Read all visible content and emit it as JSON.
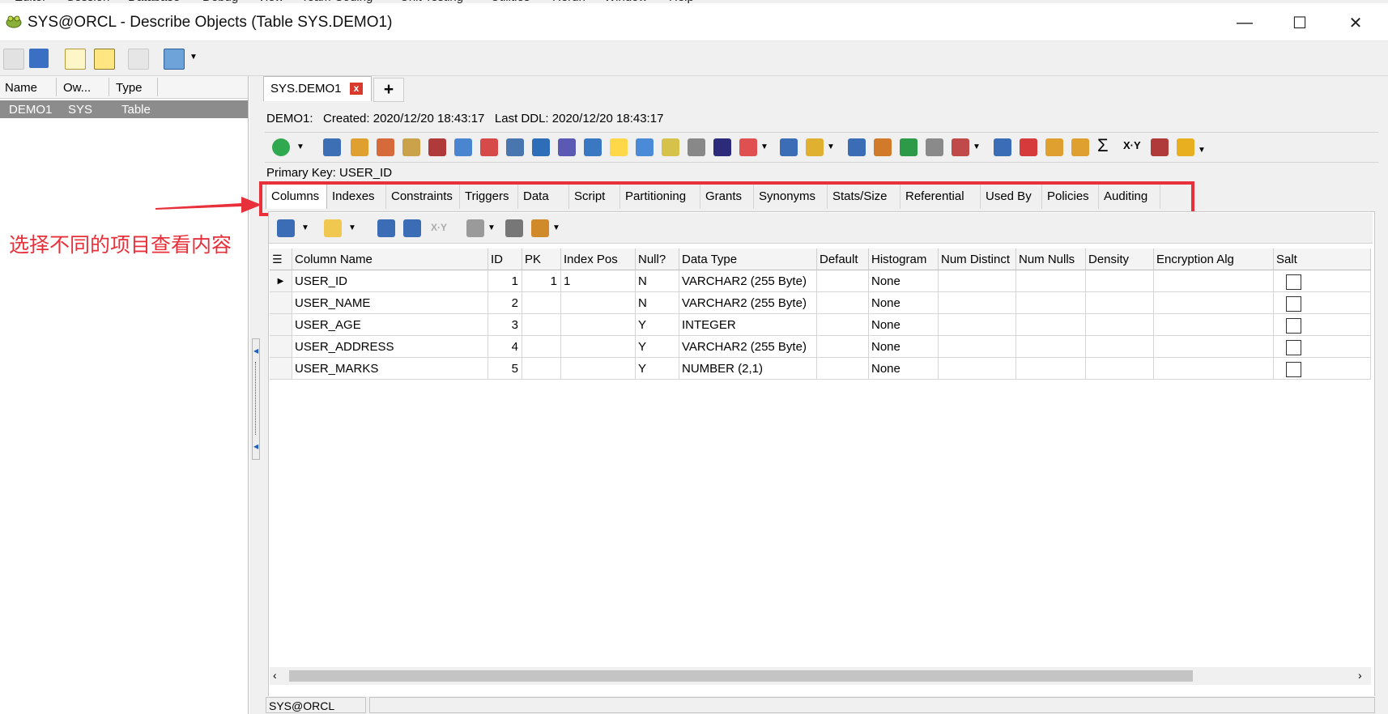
{
  "menu": [
    "Editor",
    "Session",
    "Database",
    "Debug",
    "View",
    "Team Coding",
    "Unit Testing",
    "Utilities",
    "Rerun",
    "Window",
    "Help"
  ],
  "window": {
    "title": "SYS@ORCL - Describe Objects (Table SYS.DEMO1)",
    "minimize": "—",
    "maximize": "☐",
    "close": "✕"
  },
  "left_panel": {
    "columns": [
      "Name",
      "Ow...",
      "Type"
    ],
    "rows": [
      {
        "name": "DEMO1",
        "owner": "SYS",
        "type": "Table"
      }
    ]
  },
  "doc_tab": {
    "label": "SYS.DEMO1",
    "close": "x",
    "add": "+"
  },
  "info": {
    "object": "DEMO1:",
    "created_label": "Created:",
    "created": "2020/12/20 18:43:17",
    "last_ddl_label": "Last DDL:",
    "last_ddl": "2020/12/20 18:43:17"
  },
  "primary_key": {
    "label": "Primary Key:",
    "value": "USER_ID"
  },
  "subtabs": [
    "Columns",
    "Indexes",
    "Constraints",
    "Triggers",
    "Data",
    "Script",
    "Partitioning",
    "Grants",
    "Synonyms",
    "Stats/Size",
    "Referential",
    "Used By",
    "Policies",
    "Auditing"
  ],
  "active_subtab": "Columns",
  "annotation": "选择不同的项目查看内容",
  "grid": {
    "headers": [
      "Column Name",
      "ID",
      "PK",
      "Index Pos",
      "Null?",
      "Data Type",
      "Default",
      "Histogram",
      "Num Distinct",
      "Num Nulls",
      "Density",
      "Encryption Alg",
      "Salt"
    ],
    "rows": [
      {
        "name": "USER_ID",
        "id": "1",
        "pk": "1",
        "index_pos": "1",
        "null": "N",
        "data_type": "VARCHAR2 (255 Byte)",
        "default": "",
        "histogram": "None",
        "salt": false
      },
      {
        "name": "USER_NAME",
        "id": "2",
        "pk": "",
        "index_pos": "",
        "null": "N",
        "data_type": "VARCHAR2 (255 Byte)",
        "default": "",
        "histogram": "None",
        "salt": false
      },
      {
        "name": "USER_AGE",
        "id": "3",
        "pk": "",
        "index_pos": "",
        "null": "Y",
        "data_type": "INTEGER",
        "default": "",
        "histogram": "None",
        "salt": false
      },
      {
        "name": "USER_ADDRESS",
        "id": "4",
        "pk": "",
        "index_pos": "",
        "null": "Y",
        "data_type": "VARCHAR2 (255 Byte)",
        "default": "",
        "histogram": "None",
        "salt": false
      },
      {
        "name": "USER_MARKS",
        "id": "5",
        "pk": "",
        "index_pos": "",
        "null": "Y",
        "data_type": "NUMBER (2,1)",
        "default": "",
        "histogram": "None",
        "salt": false
      }
    ]
  },
  "status": {
    "connection": "SYS@ORCL"
  },
  "colors": {
    "highlight": "#e8303a",
    "selected_row": "#8c8c8c",
    "tab_close": "#d9382b"
  }
}
